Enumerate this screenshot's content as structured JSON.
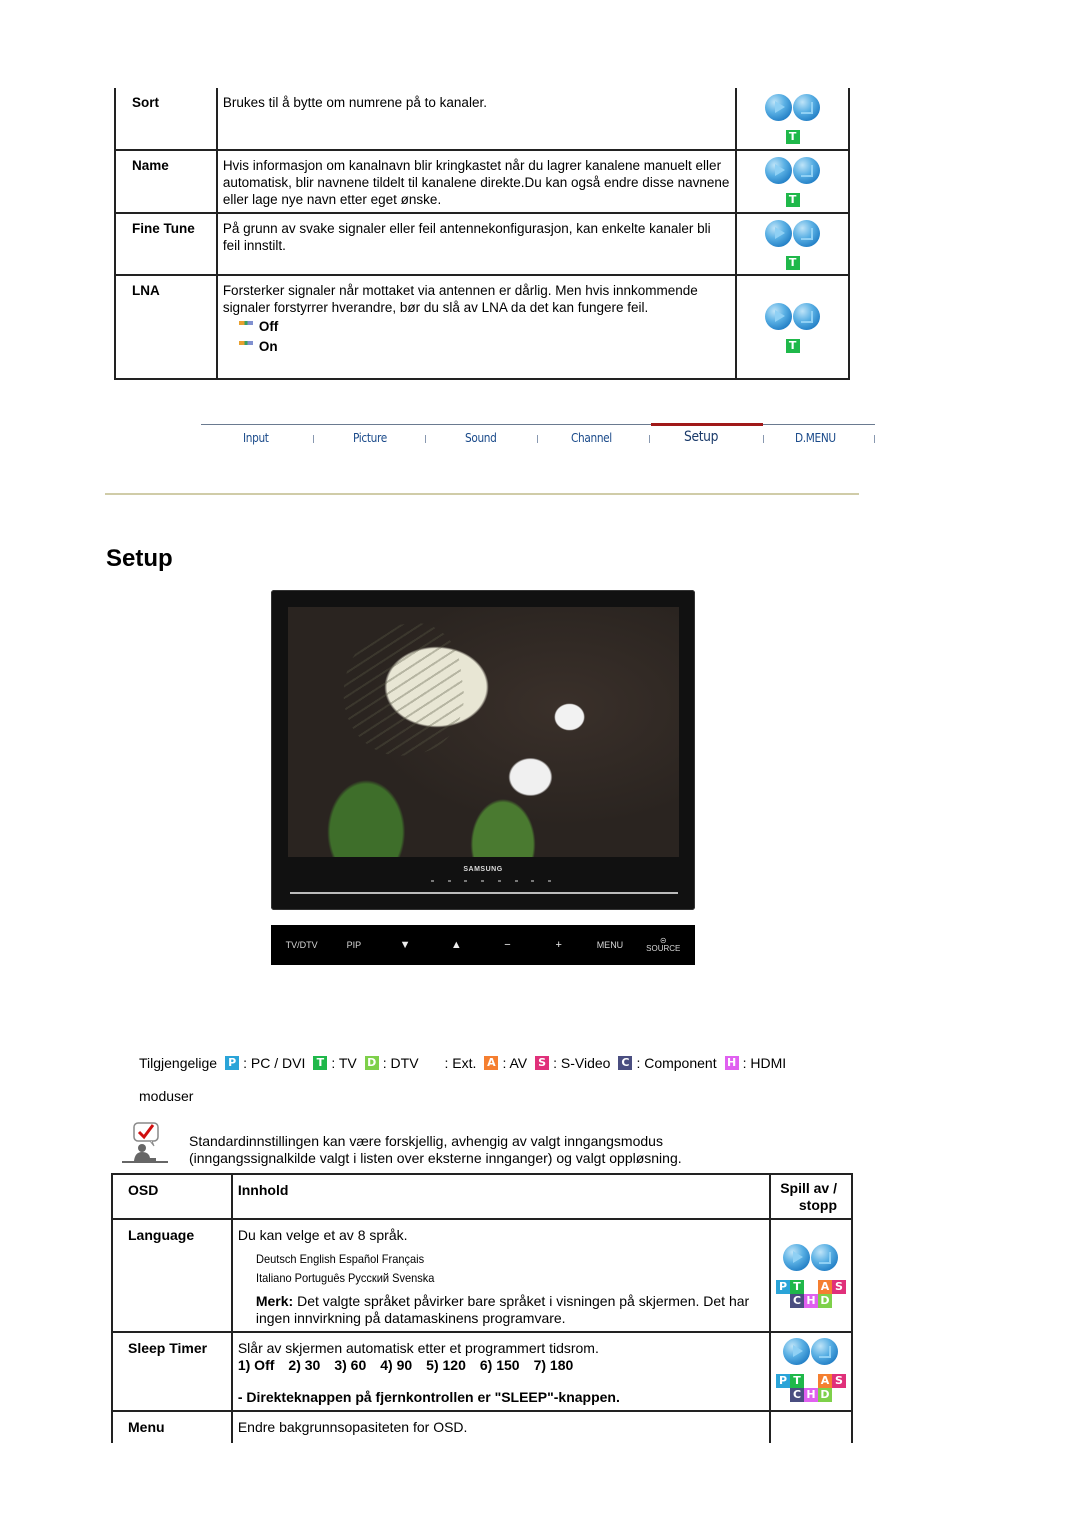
{
  "channel_table": {
    "rows": [
      {
        "label": "Sort",
        "text": "Brukes til å bytte om numrene på to kanaler.",
        "mode": "T"
      },
      {
        "label": "Name",
        "text": "Hvis informasjon om kanalnavn blir kringkastet når du lagrer kanalene manuelt eller automatisk, blir navnene tildelt til kanalene direkte.Du kan også endre disse navnene eller lage nye navn etter eget ønske.",
        "mode": "T"
      },
      {
        "label": "Fine Tune",
        "text": "På grunn av svake signaler eller feil antennekonfigurasjon, kan enkelte kanaler bli feil innstilt.",
        "mode": "T"
      },
      {
        "label": "LNA",
        "text": "Forsterker signaler når mottaket via antennen er dårlig. Men hvis innkommende signaler forstyrrer hverandre, bør du slå av LNA da det kan fungere feil.",
        "options": [
          "Off",
          "On"
        ],
        "mode": "T"
      }
    ]
  },
  "nav": {
    "items": [
      "Input",
      "Picture",
      "Sound",
      "Channel",
      "Setup",
      "D.MENU"
    ],
    "active": "Setup",
    "active_color": "#a01818"
  },
  "page_title": "Setup",
  "monitor": {
    "brand": "SAMSUNG",
    "controls": [
      "TV/DTV",
      "PIP",
      "▼",
      "▲",
      "−",
      "+",
      "MENU",
      "SOURCE"
    ]
  },
  "modes": {
    "prefix": "Tilgjengelige",
    "suffix": "moduser",
    "items": [
      {
        "badge": "P",
        "label": ": PC / DVI",
        "color": "#2aa4d8"
      },
      {
        "badge": "T",
        "label": ": TV",
        "color": "#1fb84a"
      },
      {
        "badge": "D",
        "label": ": DTV",
        "color": "#7ed04a"
      },
      {
        "badge": "",
        "label": ": Ext."
      },
      {
        "badge": "A",
        "label": ": AV",
        "color": "#f57f30"
      },
      {
        "badge": "S",
        "label": ": S-Video",
        "color": "#e0307a"
      },
      {
        "badge": "C",
        "label": ": Component",
        "color": "#4a4e80"
      },
      {
        "badge": "H",
        "label": ": HDMI",
        "color": "#e060f0"
      }
    ]
  },
  "note": "Standardinnstillingen kan være forskjellig, avhengig av valgt inngangsmodus (inngangssignalkilde valgt i listen over eksterne innganger) og valgt oppløsning.",
  "osd_table": {
    "headers": {
      "osd": "OSD",
      "content": "Innhold",
      "play": "Spill av / stopp"
    },
    "language": {
      "label": "Language",
      "intro": "Du kan velge et av 8 språk.",
      "languages_line1": "Deutsch English Español Français",
      "languages_line2": "Italiano Português Русский Svenska",
      "merk_label": "Merk:",
      "merk_text": " Det valgte språket påvirker bare språket i visningen på skjermen. Det har ingen innvirkning på datamaskinens programvare."
    },
    "sleep": {
      "label": "Sleep Timer",
      "intro": "Slår av skjermen automatisk etter et programmert tidsrom.",
      "options": [
        "1) Off",
        "2) 30",
        "3) 60",
        "4) 90",
        "5) 120",
        "6) 150",
        "7) 180"
      ],
      "direct": "- Direkteknappen på fjernkontrollen er \"SLEEP\"-knappen."
    },
    "menu": {
      "label": "Menu",
      "text": "Endre bakgrunnsopasiteten for OSD."
    }
  }
}
